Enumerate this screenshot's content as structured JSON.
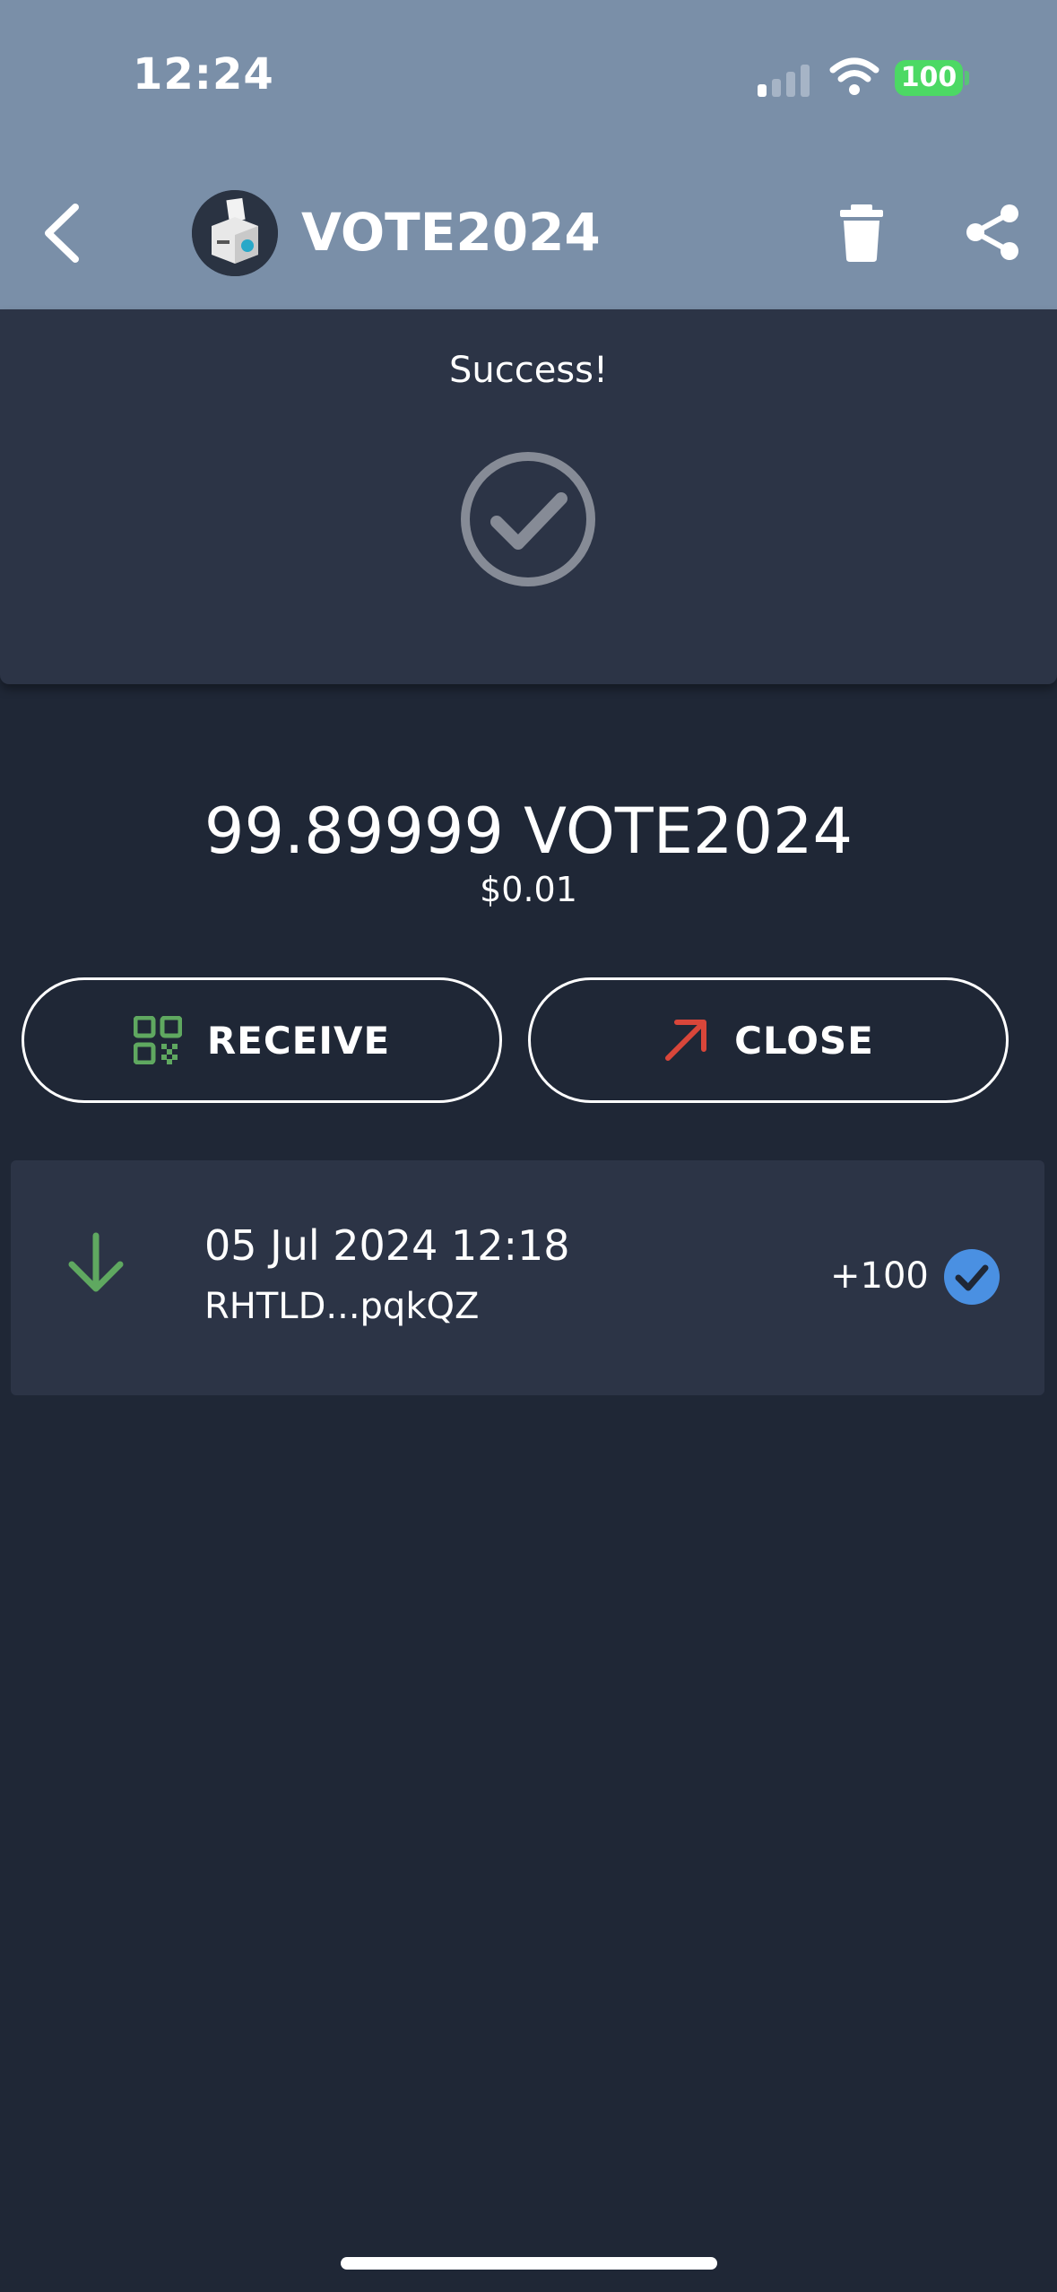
{
  "status_bar": {
    "time": "12:24",
    "battery": "100"
  },
  "header": {
    "title": "VOTE2024"
  },
  "success": {
    "message": "Success!"
  },
  "balance": {
    "amount": "99.89999 VOTE2024",
    "fiat": "$0.01"
  },
  "actions": {
    "receive_label": "RECEIVE",
    "close_label": "CLOSE"
  },
  "transactions": [
    {
      "date": "05 Jul 2024 12:18",
      "address": "RHTLD...pqkQZ",
      "amount": "+100"
    }
  ],
  "colors": {
    "header_bg": "#7a8fa8",
    "background": "#1f2736",
    "panel": "#2c3446",
    "receive_green": "#5fa860",
    "close_red": "#d9463a",
    "confirm_blue": "#4a90e2"
  }
}
